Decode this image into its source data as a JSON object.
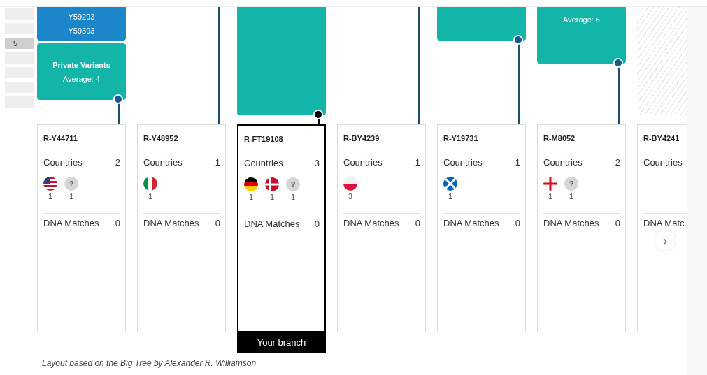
{
  "side_rows": [
    {
      "label": "",
      "selected": false
    },
    {
      "label": "",
      "selected": false
    },
    {
      "label": "5",
      "selected": true
    },
    {
      "label": "",
      "selected": false
    },
    {
      "label": "",
      "selected": false
    },
    {
      "label": "",
      "selected": false
    },
    {
      "label": "",
      "selected": false
    }
  ],
  "columns": [
    {
      "top": {
        "kind": "stack",
        "lines": [
          "Y59293",
          "Y59393"
        ],
        "title": "Private Variants",
        "subtitle": "Average: 4"
      },
      "selected": false,
      "card": {
        "name": "R-Y44711",
        "countries_label": "Countries",
        "countries_count": "2",
        "flags": [
          {
            "kind": "us",
            "count": "1"
          },
          {
            "kind": "unknown",
            "text": "?",
            "count": "1"
          }
        ],
        "dna_label": "DNA Matches",
        "dna_count": "0"
      }
    },
    {
      "top": {
        "kind": "line"
      },
      "selected": false,
      "card": {
        "name": "R-Y48952",
        "countries_label": "Countries",
        "countries_count": "1",
        "flags": [
          {
            "kind": "italy",
            "count": "1"
          }
        ],
        "dna_label": "DNA Matches",
        "dna_count": "0"
      }
    },
    {
      "top": {
        "kind": "tall"
      },
      "selected": true,
      "card": {
        "name": "R-FT19108",
        "countries_label": "Countries",
        "countries_count": "3",
        "flags": [
          {
            "kind": "germany",
            "count": "1"
          },
          {
            "kind": "denmark",
            "count": "1"
          },
          {
            "kind": "unknown",
            "text": "?",
            "count": "1"
          }
        ],
        "dna_label": "DNA Matches",
        "dna_count": "0"
      },
      "badge": "Your branch"
    },
    {
      "top": {
        "kind": "line"
      },
      "selected": false,
      "card": {
        "name": "R-BY4239",
        "countries_label": "Countries",
        "countries_count": "1",
        "flags": [
          {
            "kind": "poland",
            "count": "3"
          }
        ],
        "dna_label": "DNA Matches",
        "dna_count": "0"
      }
    },
    {
      "top": {
        "kind": "short"
      },
      "selected": false,
      "card": {
        "name": "R-Y19731",
        "countries_label": "Countries",
        "countries_count": "1",
        "flags": [
          {
            "kind": "scotland",
            "count": "1"
          }
        ],
        "dna_label": "DNA Matches",
        "dna_count": "0"
      }
    },
    {
      "top": {
        "kind": "medium",
        "subtitle": "Average: 6"
      },
      "selected": false,
      "card": {
        "name": "R-M8052",
        "countries_label": "Countries",
        "countries_count": "2",
        "flags": [
          {
            "kind": "england",
            "count": "1"
          },
          {
            "kind": "unknown",
            "text": "?",
            "count": "1"
          }
        ],
        "dna_label": "DNA Matches",
        "dna_count": "0"
      }
    },
    {
      "top": {
        "kind": "hatched"
      },
      "selected": false,
      "card": {
        "name": "R-BY4241",
        "countries_label": "Countries",
        "dna_label": "DNA Matc"
      }
    }
  ],
  "next_button": "›",
  "footer": "Layout based on the Big Tree by Alexander R. Williamson"
}
